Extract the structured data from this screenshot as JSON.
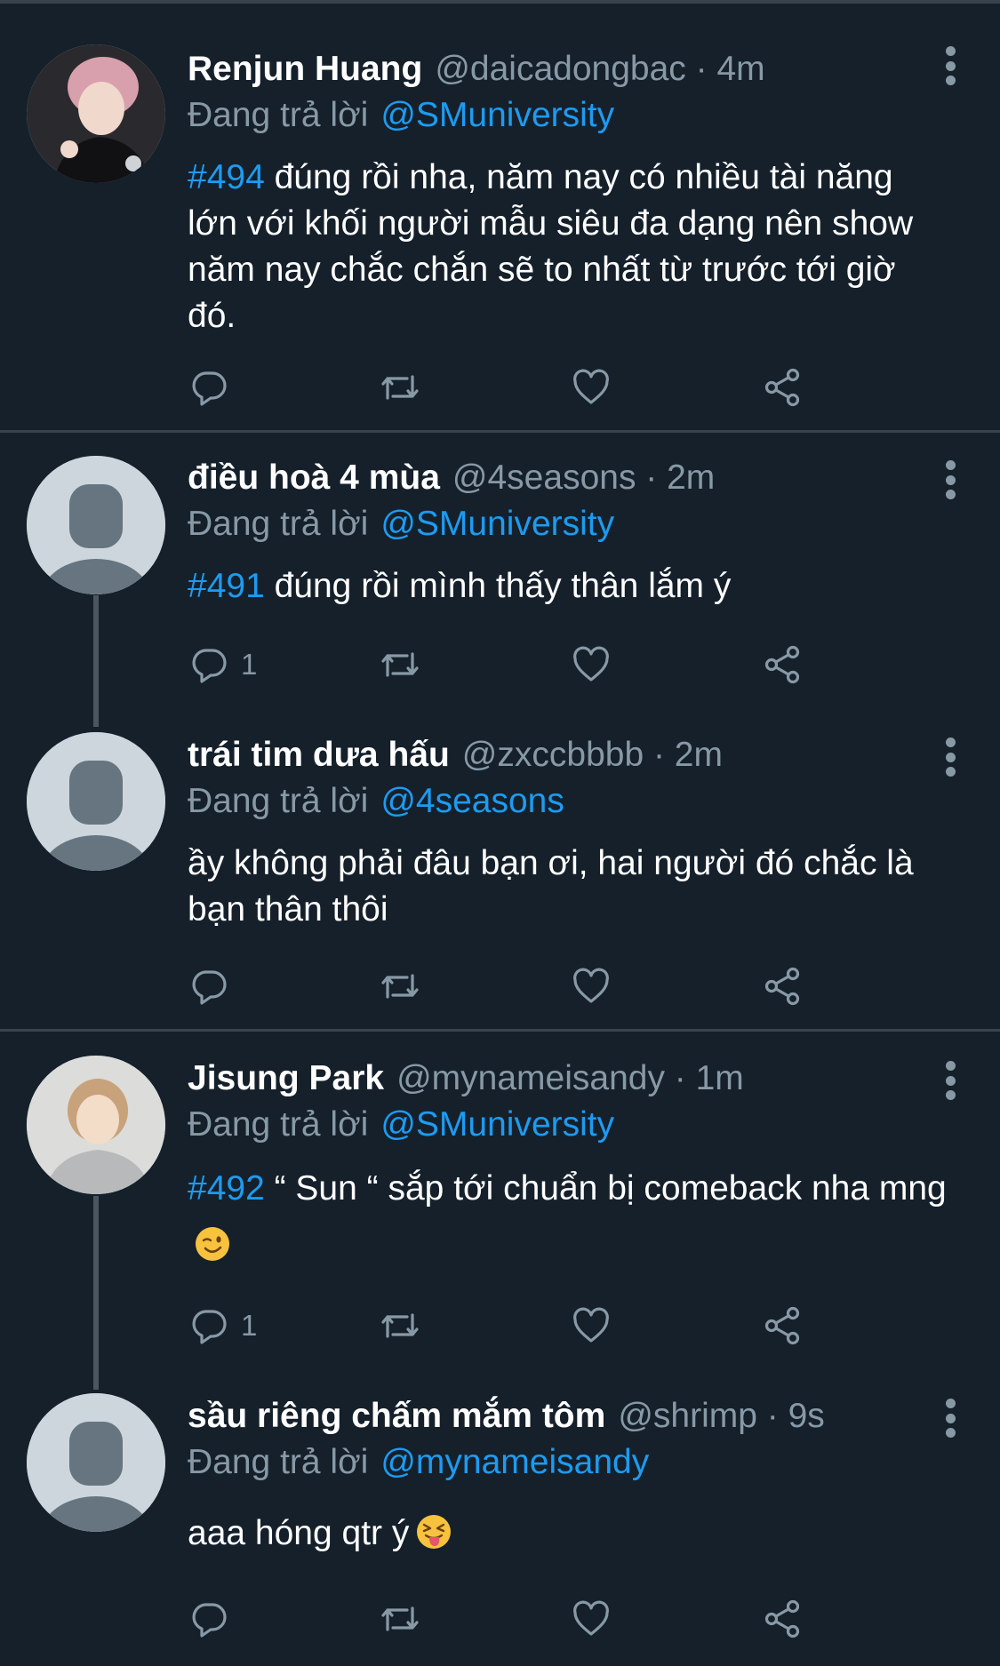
{
  "colors": {
    "background": "#15202b",
    "link": "#1d9bf0",
    "secondary": "#8899a6",
    "divider": "#38444d"
  },
  "tweets": [
    {
      "name": "Renjun Huang",
      "handle": "@daicadongbac · 4m",
      "replying_prefix": "Đang trả lời",
      "replying_to": "@SMuniversity",
      "hashtag": "#494",
      "text": " đúng rồi nha, năm nay có nhiều tài năng lớn với khối người mẫu siêu đa dạng nên show năm nay chắc chắn sẽ to nhất từ trước tới giờ đó.",
      "reply_count": "",
      "avatar": "photo"
    },
    {
      "name": "điều hoà 4 mùa",
      "handle": "@4seasons · 2m",
      "replying_prefix": "Đang trả lời",
      "replying_to": "@SMuniversity",
      "hashtag": "#491",
      "text": " đúng rồi mình thấy thân lắm ý",
      "reply_count": "1",
      "avatar": "default-profile-icon"
    },
    {
      "name": "trái tim dưa hấu",
      "handle": "@zxccbbbb · 2m",
      "replying_prefix": "Đang trả lời",
      "replying_to": "@4seasons",
      "hashtag": "",
      "text": "ầy không phải đâu bạn ơi, hai người đó chắc là bạn thân thôi",
      "reply_count": "",
      "avatar": "default-profile-icon"
    },
    {
      "name": "Jisung Park",
      "handle": "@mynameisandy · 1m",
      "replying_prefix": "Đang trả lời",
      "replying_to": "@SMuniversity",
      "hashtag": "#492",
      "text": " “ Sun “ sắp tới chuẩn bị comeback nha mng",
      "emoji": "winking-face-emoji",
      "reply_count": "1",
      "avatar": "photo"
    },
    {
      "name": "sầu riêng chấm mắm tôm",
      "handle": "@shrimp · 9s",
      "replying_prefix": "Đang trả lời",
      "replying_to": "@mynameisandy",
      "hashtag": "",
      "text": "aaa hóng qtr ý",
      "emoji": "tongue-out-emoji",
      "reply_count": "",
      "avatar": "default-profile-icon"
    }
  ],
  "actions": [
    "reply-icon",
    "retweet-icon",
    "like-icon",
    "share-icon"
  ]
}
